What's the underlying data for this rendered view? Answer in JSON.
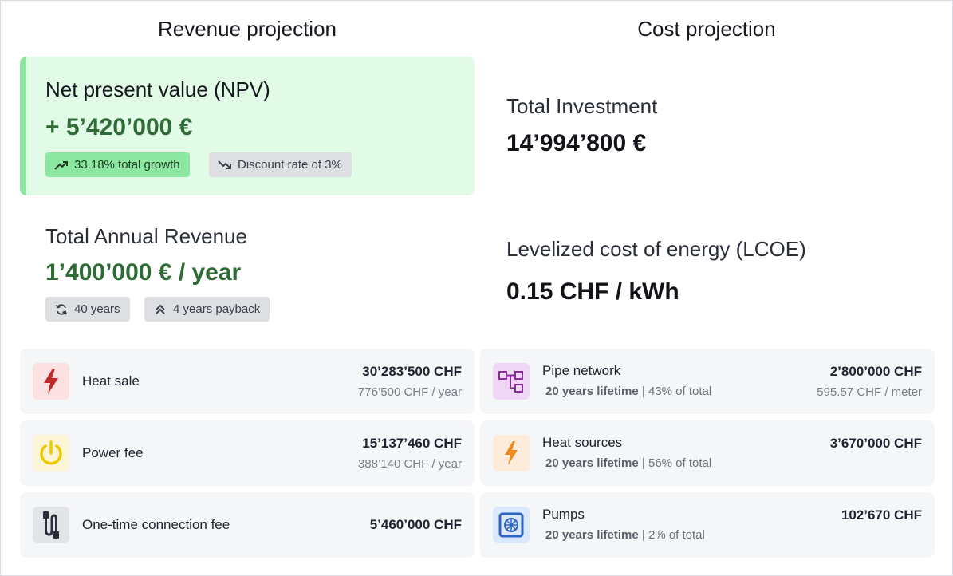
{
  "revenue": {
    "title": "Revenue projection",
    "npv": {
      "label": "Net present value (NPV)",
      "value": "+ 5’420’000 €",
      "growth_badge": "33.18% total growth",
      "discount_badge": "Discount rate of 3%"
    },
    "annual": {
      "label": "Total Annual Revenue",
      "value": "1’400’000 € / year",
      "years_badge": "40 years",
      "payback_badge": "4 years payback"
    },
    "items": [
      {
        "name": "Heat sale",
        "amount": "30’283’500 CHF",
        "per": "776’500 CHF / year",
        "icon": "lightning-icon"
      },
      {
        "name": "Power fee",
        "amount": "15’137’460 CHF",
        "per": "388’140 CHF / year",
        "icon": "power-icon"
      },
      {
        "name": "One-time connection fee",
        "amount": "5’460’000  CHF",
        "icon": "plug-icon"
      }
    ]
  },
  "cost": {
    "title": "Cost projection",
    "investment": {
      "label": "Total Investment",
      "value": "14’994’800 €"
    },
    "lcoe": {
      "label": "Levelized cost of energy (LCOE)",
      "value": "0.15 CHF / kWh"
    },
    "items": [
      {
        "name": "Pipe network",
        "lifetime": "20 years lifetime",
        "share": " | 43% of total",
        "amount": "2’800’000 CHF",
        "per": "595.57 CHF / meter",
        "icon": "network-icon"
      },
      {
        "name": "Heat sources",
        "lifetime": "20 years lifetime",
        "share": " | 56% of total",
        "amount": "3’670’000 CHF",
        "icon": "bolt-icon"
      },
      {
        "name": "Pumps",
        "lifetime": "20 years lifetime",
        "share": " | 2% of total",
        "amount": "102’670 CHF",
        "icon": "pump-icon"
      }
    ]
  },
  "colors": {
    "npv_bg": "#e2fbe6",
    "npv_accent": "#8fe6a1",
    "green_text": "#2f6b36",
    "card_bg": "#f5f6f7"
  }
}
